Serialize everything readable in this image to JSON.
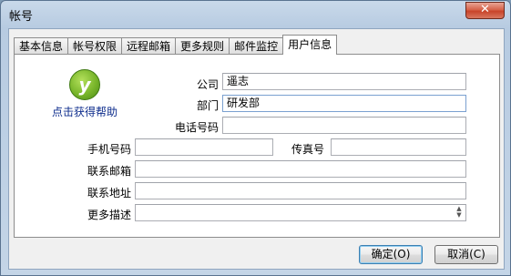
{
  "window": {
    "title": "帐号",
    "close_glyph": "✕"
  },
  "tabs": [
    {
      "label": "基本信息"
    },
    {
      "label": "帐号权限"
    },
    {
      "label": "远程邮箱"
    },
    {
      "label": "更多规则"
    },
    {
      "label": "邮件监控"
    },
    {
      "label": "用户信息",
      "active": true
    }
  ],
  "help": {
    "label": "点击获得帮助",
    "icon": "help-y-icon",
    "glyph": "y"
  },
  "form": {
    "company": {
      "label": "公司",
      "value": "遥志"
    },
    "department": {
      "label": "部门",
      "value": "研发部"
    },
    "phone": {
      "label": "电话号码",
      "value": ""
    },
    "mobile": {
      "label": "手机号码",
      "value": ""
    },
    "fax": {
      "label": "传真号",
      "value": ""
    },
    "email": {
      "label": "联系邮箱",
      "value": ""
    },
    "address": {
      "label": "联系地址",
      "value": ""
    },
    "description": {
      "label": "更多描述",
      "value": ""
    }
  },
  "buttons": {
    "ok": "确定(O)",
    "cancel": "取消(C)"
  }
}
